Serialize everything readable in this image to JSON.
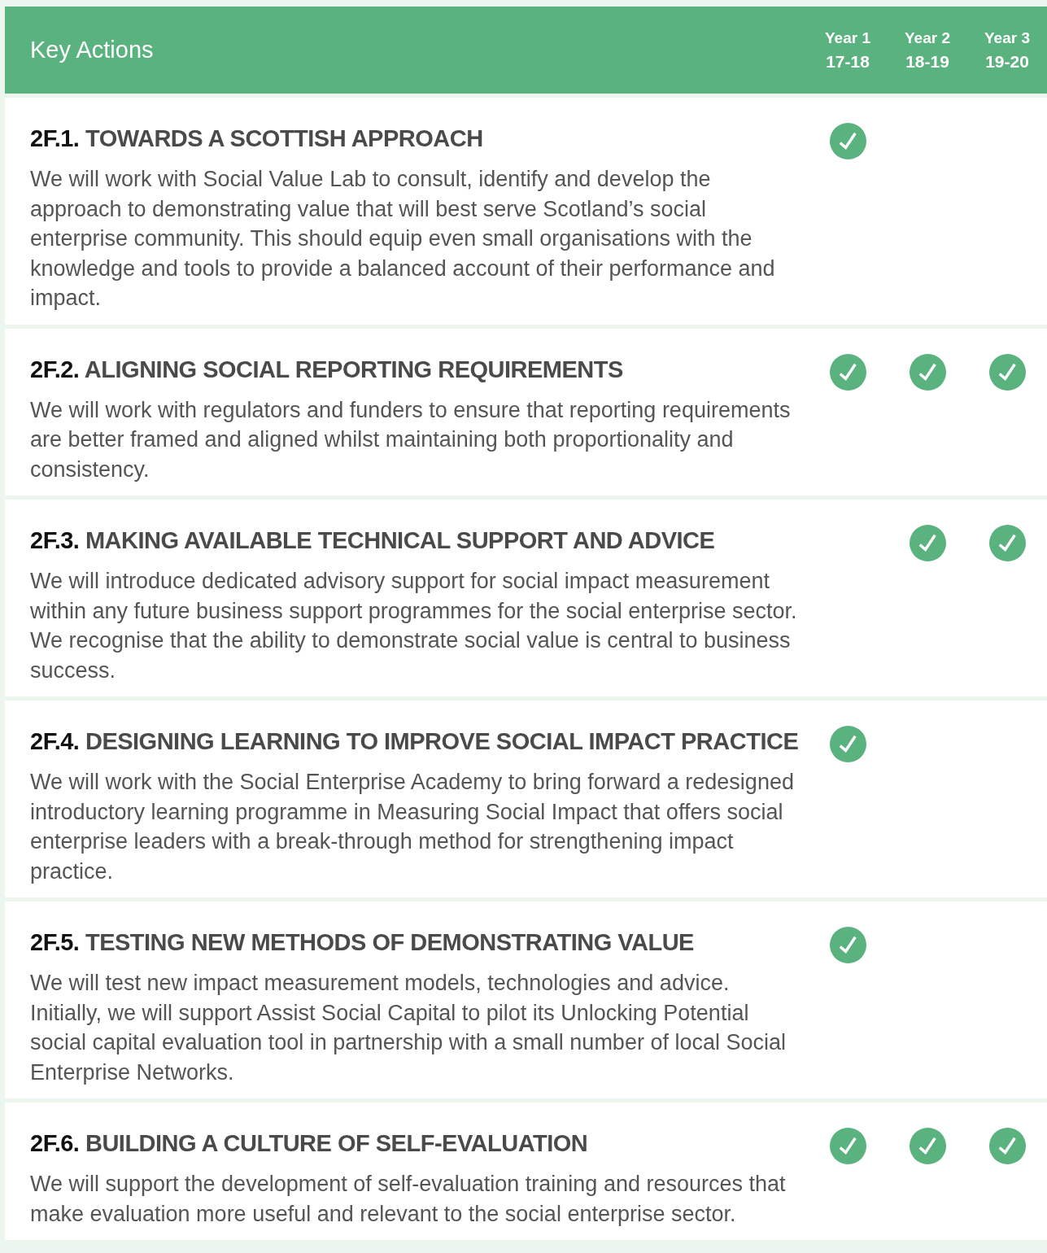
{
  "header": {
    "title": "Key Actions",
    "columns": [
      {
        "year": "Year 1",
        "period": "17-18"
      },
      {
        "year": "Year 2",
        "period": "18-19"
      },
      {
        "year": "Year 3",
        "period": "19-20"
      }
    ]
  },
  "actions": [
    {
      "code": "2F.1.",
      "title": "TOWARDS A SCOTTISH APPROACH",
      "body": "We will work with Social Value Lab to consult, identify and develop the approach to demonstrating value that will best serve Scotland’s social enterprise community. This should equip even small organisations with the knowledge and tools to provide a balanced account of their performance and impact.",
      "checks": [
        true,
        false,
        false
      ]
    },
    {
      "code": "2F.2.",
      "title": "ALIGNING SOCIAL REPORTING REQUIREMENTS",
      "body": "We will work with regulators and funders to ensure that reporting requirements are better framed and aligned whilst maintaining both proportionality and consistency.",
      "checks": [
        true,
        true,
        true
      ]
    },
    {
      "code": "2F.3.",
      "title": "MAKING AVAILABLE TECHNICAL SUPPORT AND ADVICE",
      "body": "We will introduce dedicated advisory support for social impact measurement within any future business support programmes for the social enterprise sector. We recognise that the ability to demonstrate social value is central to business success.",
      "checks": [
        false,
        true,
        true
      ]
    },
    {
      "code": "2F.4.",
      "title": "DESIGNING LEARNING TO IMPROVE SOCIAL IMPACT PRACTICE",
      "body": "We will work with the Social Enterprise Academy to bring forward a redesigned introductory learning programme in Measuring Social Impact that offers social enterprise leaders with a break-through method for strengthening impact practice.",
      "checks": [
        true,
        false,
        false
      ]
    },
    {
      "code": "2F.5.",
      "title": "TESTING NEW METHODS OF DEMONSTRATING VALUE",
      "body": "We will test new impact measurement models, technologies and advice. Initially, we will support Assist Social Capital to pilot its Unlocking Potential social capital evaluation tool in partnership with a small number of local Social Enterprise Networks.",
      "checks": [
        true,
        false,
        false
      ]
    },
    {
      "code": "2F.6.",
      "title": "BUILDING A CULTURE OF SELF-EVALUATION",
      "body": "We will support the development of self-evaluation training and resources that make evaluation more useful and relevant to the social enterprise sector.",
      "checks": [
        true,
        true,
        true
      ]
    }
  ]
}
